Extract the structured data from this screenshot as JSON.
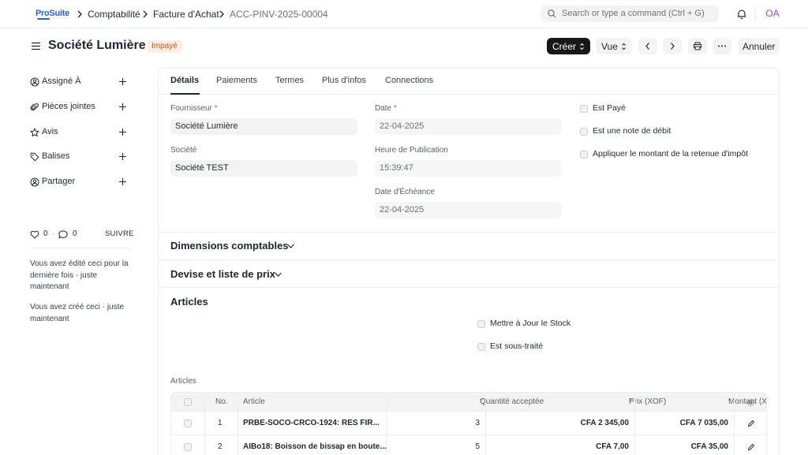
{
  "app": {
    "logo_text": "ProSuite",
    "avatar_initials": "OA"
  },
  "breadcrumb": [
    "Comptabilité",
    "Facture d'Achat",
    "ACC-PINV-2025-00004"
  ],
  "search": {
    "placeholder": "Search or type a command (Ctrl + G)"
  },
  "header": {
    "title": "Société Lumière",
    "status": "Impayé",
    "create_label": "Créer",
    "view_label": "Vue",
    "cancel_label": "Annuler"
  },
  "sidebar": {
    "items": [
      {
        "label": "Assigné À",
        "icon": "assign-icon"
      },
      {
        "label": "Pièces jointes",
        "icon": "paperclip-icon"
      },
      {
        "label": "Avis",
        "icon": "star-icon"
      },
      {
        "label": "Balises",
        "icon": "tag-icon"
      },
      {
        "label": "Partager",
        "icon": "share-icon"
      }
    ],
    "likes": "0",
    "comments": "0",
    "separator": "·",
    "follow_label": "SUIVRE",
    "activity": [
      "Vous avez édité ceci pour la dernière fois · juste maintenant",
      "Vous avez créé ceci · juste maintenant"
    ]
  },
  "tabs": [
    "Détails",
    "Paiements",
    "Termes",
    "Plus d'infos",
    "Connections"
  ],
  "form": {
    "supplier": {
      "label": "Fournisseur",
      "required": "*",
      "value": "Société Lumière"
    },
    "company": {
      "label": "Société",
      "value": "Société TEST"
    },
    "date": {
      "label": "Date",
      "required": "*",
      "value": "22-04-2025"
    },
    "posting_time": {
      "label": "Heure de Publication",
      "value": "15:39:47"
    },
    "due_date": {
      "label": "Date d'Échéance",
      "value": "22-04-2025"
    },
    "checkboxes": [
      "Est Payé",
      "Est une note de débit",
      "Appliquer le montant de la retenue d'impôt"
    ]
  },
  "sections": {
    "accounting_dimensions": "Dimensions comptables",
    "currency_price_list": "Devise et liste de prix",
    "items": "Articles"
  },
  "items_section": {
    "checkboxes": [
      "Mettre à Jour le Stock",
      "Est sous-traité"
    ],
    "table_label": "Articles",
    "columns": {
      "no": "No.",
      "item": "Article",
      "qty": "Quantité acceptée",
      "rate": "Prix (XOF)",
      "amount": "Montant (XOF)",
      "required": "*"
    },
    "rows": [
      {
        "no": "1",
        "item": "PRBE-SOCO-CRCO-1924: RES FIR...",
        "qty": "3",
        "rate": "CFA 2 345,00",
        "amount": "CFA 7 035,00"
      },
      {
        "no": "2",
        "item": "AIBo18: Boisson de bissap en boute...",
        "qty": "5",
        "rate": "CFA 7,00",
        "amount": "CFA 35,00"
      }
    ]
  }
}
